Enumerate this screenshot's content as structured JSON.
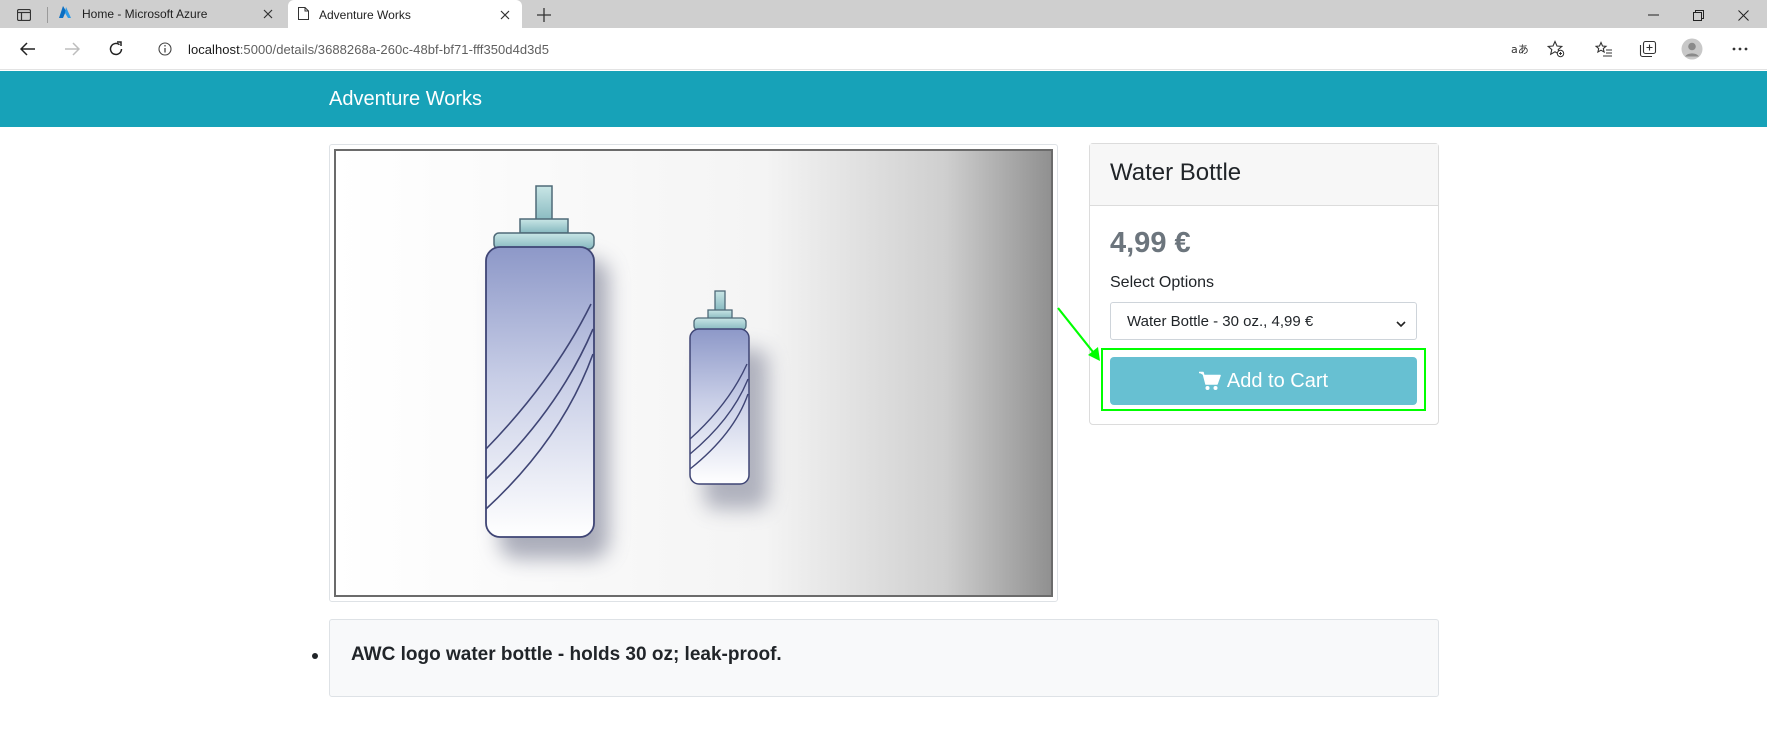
{
  "browser": {
    "tabs": [
      {
        "title": "Home - Microsoft Azure",
        "icon": "azure-icon"
      },
      {
        "title": "Adventure Works",
        "icon": "page-icon"
      }
    ],
    "url_host": "localhost",
    "url_path": ":5000/details/3688268a-260c-48bf-bf71-fff350d4d3d5"
  },
  "site": {
    "brand": "Adventure Works",
    "accent_color": "#17a2b8"
  },
  "product": {
    "title": "Water Bottle",
    "price": "4,99 €",
    "options_label": "Select Options",
    "selected_option": "Water Bottle - 30 oz., 4,99 €",
    "add_to_cart_label": "Add to Cart",
    "description": "AWC logo water bottle - holds 30 oz; leak-proof.",
    "cart_button_color": "#67c0d2"
  },
  "annotation": {
    "highlight_color": "#00ff00"
  }
}
